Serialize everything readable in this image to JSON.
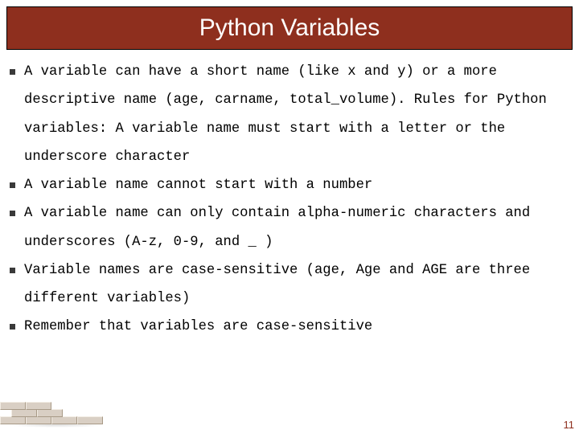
{
  "title": "Python Variables",
  "bullets": [
    "A variable can have a short name (like x and y) or a more descriptive name (age, carname, total_volume). Rules for Python variables: A variable name must start with a letter or the underscore character",
    "A variable name cannot start with a number",
    "A variable name can only contain alpha-numeric characters and underscores (A-z, 0-9, and _ )",
    "Variable names are case-sensitive (age, Age and AGE are three different variables)",
    "Remember that variables are case-sensitive"
  ],
  "page_number": "11"
}
